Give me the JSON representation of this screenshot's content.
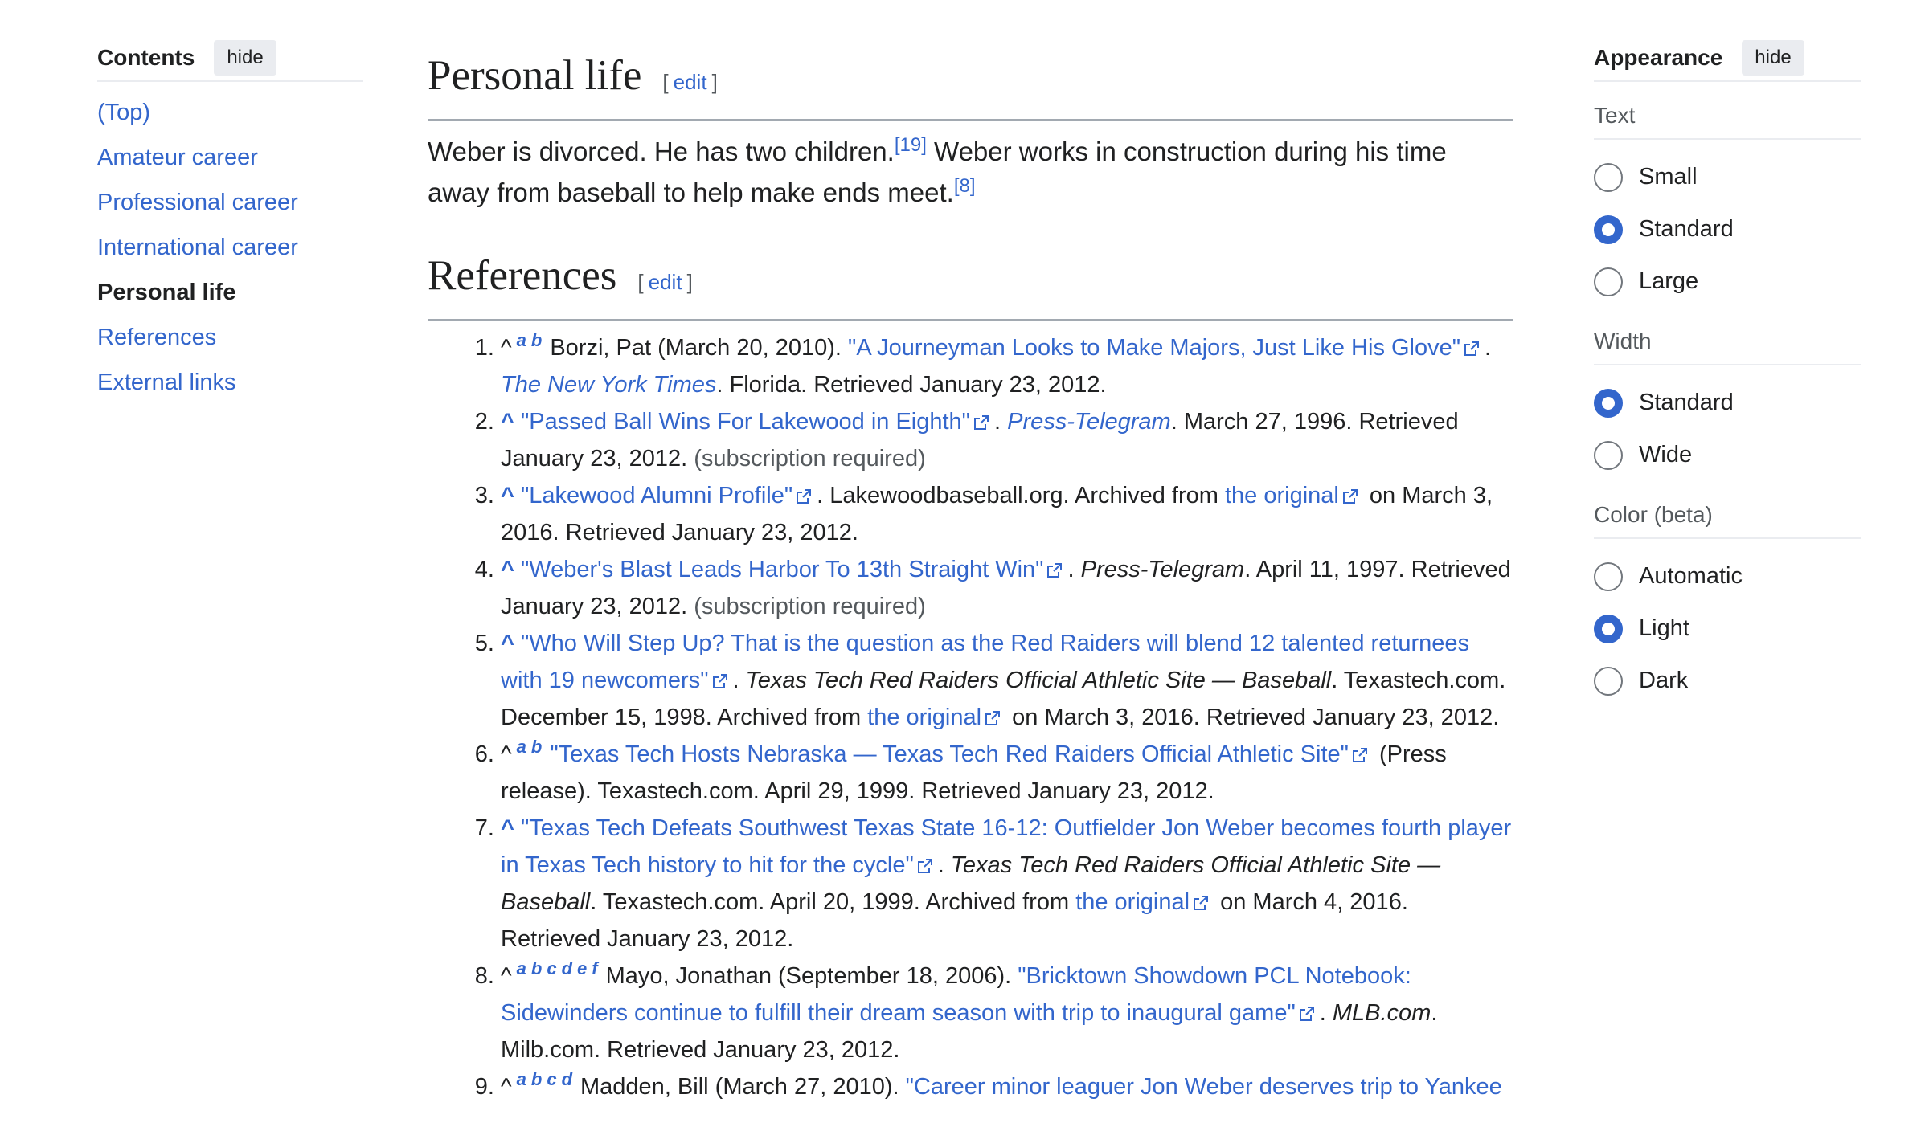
{
  "toc": {
    "title": "Contents",
    "hide": "hide",
    "items": [
      {
        "label": "(Top)"
      },
      {
        "label": "Amateur career"
      },
      {
        "label": "Professional career"
      },
      {
        "label": "International career"
      },
      {
        "label": "Personal life"
      },
      {
        "label": "References"
      },
      {
        "label": "External links"
      }
    ]
  },
  "personal": {
    "heading": "Personal life",
    "edit_open": "[",
    "edit": "edit",
    "edit_close": "]",
    "text1": "Weber is divorced. He has two children.",
    "cite1": "[19]",
    "text2": " Weber works in construction during his time away from baseball to help make ends meet.",
    "cite2": "[8]"
  },
  "references": {
    "heading": "References",
    "edit": "edit",
    "items": [
      {
        "caret": "^",
        "back": [
          "a",
          "b"
        ],
        "pre": "Borzi, Pat (March 20, 2010). ",
        "link": "\"A Journeyman Looks to Make Majors, Just Like His Glove\"",
        "pub": "The New York Times",
        "post": ". Florida. Retrieved January 23, 2012."
      },
      {
        "caret": "^",
        "link": "\"Passed Ball Wins For Lakewood in Eighth\"",
        "pub": "Press-Telegram",
        "post": ". March 27, 1996. Retrieved January 23, 2012. ",
        "reg": "(subscription required)"
      },
      {
        "caret": "^",
        "link": "\"Lakewood Alumni Profile\"",
        "mid": ". Lakewoodbaseball.org. Archived from ",
        "orig": "the original",
        "post": " on March 3, 2016. Retrieved January 23, 2012."
      },
      {
        "caret": "^",
        "link": "\"Weber's Blast Leads Harbor To 13th Straight Win\"",
        "pub": "Press-Telegram",
        "post": ". April 11, 1997. Retrieved January 23, 2012. ",
        "reg": "(subscription required)"
      },
      {
        "caret": "^",
        "link": "\"Who Will Step Up? That is the question as the Red Raiders will blend 12 talented returnees with 19 newcomers\"",
        "pub": "Texas Tech Red Raiders Official Athletic Site — Baseball",
        "mid": ". Texastech.com. December 15, 1998. Archived from ",
        "orig": "the original",
        "post": " on March 3, 2016. Retrieved January 23, 2012."
      },
      {
        "caret": "^",
        "back": [
          "a",
          "b"
        ],
        "link": "\"Texas Tech Hosts Nebraska — Texas Tech Red Raiders Official Athletic Site\"",
        "post": " (Press release). Texastech.com. April 29, 1999. Retrieved January 23, 2012."
      },
      {
        "caret": "^",
        "link": "\"Texas Tech Defeats Southwest Texas State 16-12: Outfielder Jon Weber becomes fourth player in Texas Tech history to hit for the cycle\"",
        "pub": "Texas Tech Red Raiders Official Athletic Site — Baseball",
        "mid": ". Texastech.com. April 20, 1999. Archived from ",
        "orig": "the original",
        "post": " on March 4, 2016. Retrieved January 23, 2012."
      },
      {
        "caret": "^",
        "back": [
          "a",
          "b",
          "c",
          "d",
          "e",
          "f"
        ],
        "pre": "Mayo, Jonathan (September 18, 2006). ",
        "link": "\"Bricktown Showdown PCL Notebook: Sidewinders continue to fulfill their dream season with trip to inaugural game\"",
        "pub": "MLB.com",
        "post": ". Milb.com. Retrieved January 23, 2012."
      },
      {
        "caret": "^",
        "back": [
          "a",
          "b",
          "c",
          "d"
        ],
        "pre": "Madden, Bill (March 27, 2010). ",
        "link": "\"Career minor leaguer Jon Weber deserves trip to Yankee"
      }
    ]
  },
  "appearance": {
    "title": "Appearance",
    "hide": "hide",
    "text_label": "Text",
    "text_options": [
      "Small",
      "Standard",
      "Large"
    ],
    "text_selected": "Standard",
    "width_label": "Width",
    "width_options": [
      "Standard",
      "Wide"
    ],
    "width_selected": "Standard",
    "color_label": "Color (beta)",
    "color_options": [
      "Automatic",
      "Light",
      "Dark"
    ],
    "color_selected": "Light"
  },
  "colors": {
    "link": "#3366cc",
    "text": "#202122",
    "muted": "#54595d",
    "rule": "#a2a9b1"
  }
}
